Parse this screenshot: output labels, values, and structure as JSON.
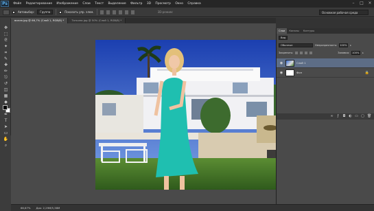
{
  "app": {
    "logo": "Ps"
  },
  "menu": [
    "Файл",
    "Редактирование",
    "Изображение",
    "Слои",
    "Текст",
    "Выделение",
    "Фильтр",
    "3D",
    "Просмотр",
    "Окно",
    "Справка"
  ],
  "window_controls": {
    "minimize": "–",
    "maximize": "□",
    "close": "×"
  },
  "options": {
    "autoselect_label": "Автовыбор:",
    "autoselect_value": "Группа",
    "transform_label": "Показать упр. элем.",
    "mode_3d_label": "3D-режим:",
    "workspace": "Основная рабочая среда"
  },
  "tabs": [
    {
      "label": "вилла.jpg @ 66,7% (Слой 1, RGB/8) *",
      "active": true
    },
    {
      "label": "Татьяна.jpg @ 50% (Слой 1, RGB/8) *",
      "active": false
    }
  ],
  "tools": [
    "move-tool",
    "marquee-tool",
    "lasso-tool",
    "magic-wand-tool",
    "crop-tool",
    "eyedropper-tool",
    "healing-brush-tool",
    "brush-tool",
    "clone-stamp-tool",
    "history-brush-tool",
    "eraser-tool",
    "gradient-tool",
    "blur-tool",
    "dodge-tool",
    "pen-tool",
    "type-tool",
    "path-selection-tool",
    "shape-tool",
    "hand-tool",
    "zoom-tool"
  ],
  "tool_glyphs": [
    "✥",
    "⬚",
    "ᘓ",
    "✦",
    "⌗",
    "✎",
    "✚",
    "✏",
    "⎋",
    "↺",
    "◫",
    "▦",
    "◆",
    "●",
    "✒",
    "T",
    "➤",
    "▭",
    "✋",
    "⌕"
  ],
  "status": {
    "zoom": "66,67%",
    "doc": "Док: 2,29M/5,38M"
  },
  "panels": {
    "tabs": [
      "Слои",
      "Каналы",
      "Контуры"
    ],
    "filter_label": "Вид",
    "blend_mode": "Обычные",
    "opacity_label": "Непрозрачность:",
    "opacity_value": "100%",
    "lock_label": "Закрепить:",
    "fill_label": "Заливка:",
    "fill_value": "100%",
    "layers": [
      {
        "name": "Слой 1",
        "selected": true
      },
      {
        "name": "Фон",
        "selected": false
      }
    ]
  },
  "colors": {
    "selection": "#5d6d86",
    "foreground": "#000000",
    "background": "#ffffff"
  }
}
